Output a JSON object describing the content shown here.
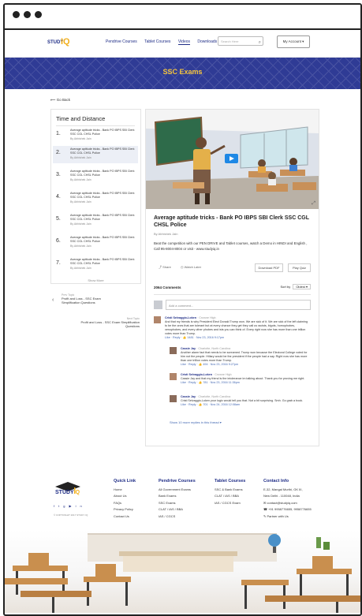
{
  "nav": {
    "logo_text": "STUDY",
    "logo_num": "IQ",
    "links": [
      "Pendrive Courses",
      "Tablet Courses",
      "Videos",
      "Downloads"
    ],
    "active_link": "Videos",
    "search_placeholder": "Search Here",
    "account_label": "My Account"
  },
  "banner": {
    "title": "SSC Exams"
  },
  "back_label": "Go Back",
  "sidebar": {
    "title": "Time and Distance",
    "items": [
      {
        "num": "1.",
        "title": "Average aptitude tricks - Bank PO IBPS SBI Clerk SSC CGL CHSL Police",
        "author": "By Abhishek Jain"
      },
      {
        "num": "2.",
        "title": "Average aptitude tricks - Bank PO IBPS SBI Clerk SSC CGL CHSL Police",
        "author": "By Abhishek Jain"
      },
      {
        "num": "3.",
        "title": "Average aptitude tricks - Bank PO IBPS SBI Clerk SSC CGL CHSL Police",
        "author": "By Abhishek Jain"
      },
      {
        "num": "4.",
        "title": "Average aptitude tricks - Bank PO IBPS SBI Clerk SSC CGL CHSL Police",
        "author": "By Abhishek Jain"
      },
      {
        "num": "5.",
        "title": "Average aptitude tricks - Bank PO IBPS SBI Clerk SSC CGL CHSL Police",
        "author": "By Abhishek Jain"
      },
      {
        "num": "6.",
        "title": "Average aptitude tricks - Bank PO IBPS SBI Clerk SSC CGL CHSL Police",
        "author": "By Abhishek Jain"
      },
      {
        "num": "7.",
        "title": "Average aptitude tricks - Bank PO IBPS SBI Clerk SSC CGL CHSL Police",
        "author": "By Abhishek Jain"
      }
    ],
    "show_more": "Show More"
  },
  "prev": {
    "label": "Prev Topic",
    "title": "Profit and Loss - SSC Exam Simplification Questions"
  },
  "next": {
    "label": "Next Topic",
    "title": "Profit and Loss - SSC Exam Simplification Questions"
  },
  "video": {
    "title": "Average aptitude tricks - Bank PO IBPS SBI Clerk SSC CGL CHSL Police",
    "author": "By Abhishek Jain",
    "description": "Beat the competition with our PEN DRIVE and Tablet courses, watch a Demo in HINDI and English , Call 95-8004-8004 or visit - www.studyiq.in",
    "share": "Share",
    "watch_later": "Watch Later",
    "download_pdf": "Download PDF",
    "play_quiz": "Play Quiz"
  },
  "comments": {
    "count_label": "2064 Comments",
    "sort_label": "Sort by",
    "sort_value": "Oldest",
    "add_placeholder": "Add a comment...",
    "list": [
      {
        "name": "Cristi Selvaggio-Loken",
        "loc": "· Crowne High",
        "text": "And that my friends is why President Elect Donald Trump won. We are sick of it. We are sick of the left claiming to be the ones that are tolerant but at every chance they get they call us racists, bigots, homophobes, xenophobes, and every other phobes and ists you can think of. Every right now she has more than one trillion votes more than Trump.",
        "meta": "Like · Reply · 👍 1481 · Nov 23, 2016 9:17pm"
      },
      {
        "name": "Cassie Jay",
        "loc": "· Charlotte, North Carolina",
        "text": "Another alarm fact that needs to be screamed. Trump won because the Electoral College voted for him not the people. Hillary would be the president if the people had a say. Right now she has more than one trillion votes more than Trump.",
        "meta": "Like · Reply · 👍 494 · Nov 23, 2016 9:27pm"
      },
      {
        "name": "Cristi Selvaggio-Loken",
        "loc": "· Crowne High",
        "text": "Cassie Jay and that my friend is the intolerance im talking about. Thank you for proving me right.",
        "meta": "Like · Reply · 👍 781 · Nov 23, 2016 11:36pm"
      },
      {
        "name": "Cassie Jay",
        "loc": "· Charlotte, North Carolina",
        "text": "Cristi Selvaggio-Loken your logic would tell you that. Not a bit surprising. Smh. Go grab a book.",
        "meta": "Like · Reply · 👍 701 · Nov 24, 2016 12:08am"
      }
    ],
    "show_replies": "Show 10 more replies in this thread ▾"
  },
  "footer": {
    "copyright": "© COPYRIGHT 2017 STUDY IQ",
    "cols": [
      {
        "head": "Quick Link",
        "items": [
          "Home",
          "About Us",
          "FAQs",
          "Privacy Policy",
          "Contact Us"
        ]
      },
      {
        "head": "Pendrive Courses",
        "items": [
          "All Government Exams",
          "Bank Exams",
          "SSC Exams",
          "CLAT / IAS / BBA",
          "IAS / CGCS"
        ]
      },
      {
        "head": "Tablet Courses",
        "items": [
          "SSC & Bank Exams",
          "CLAT / IAS / BBA",
          "IAS / CGCS Exam"
        ]
      },
      {
        "head": "Contact Info",
        "items": [
          "E-32, Mangal Murthi, GK III,",
          "New Delhi - 110048, India",
          "✉ contact@studyiq.com",
          "☎ +91 9958776655, 9958776655",
          "✎ Partner with Us"
        ]
      }
    ]
  }
}
